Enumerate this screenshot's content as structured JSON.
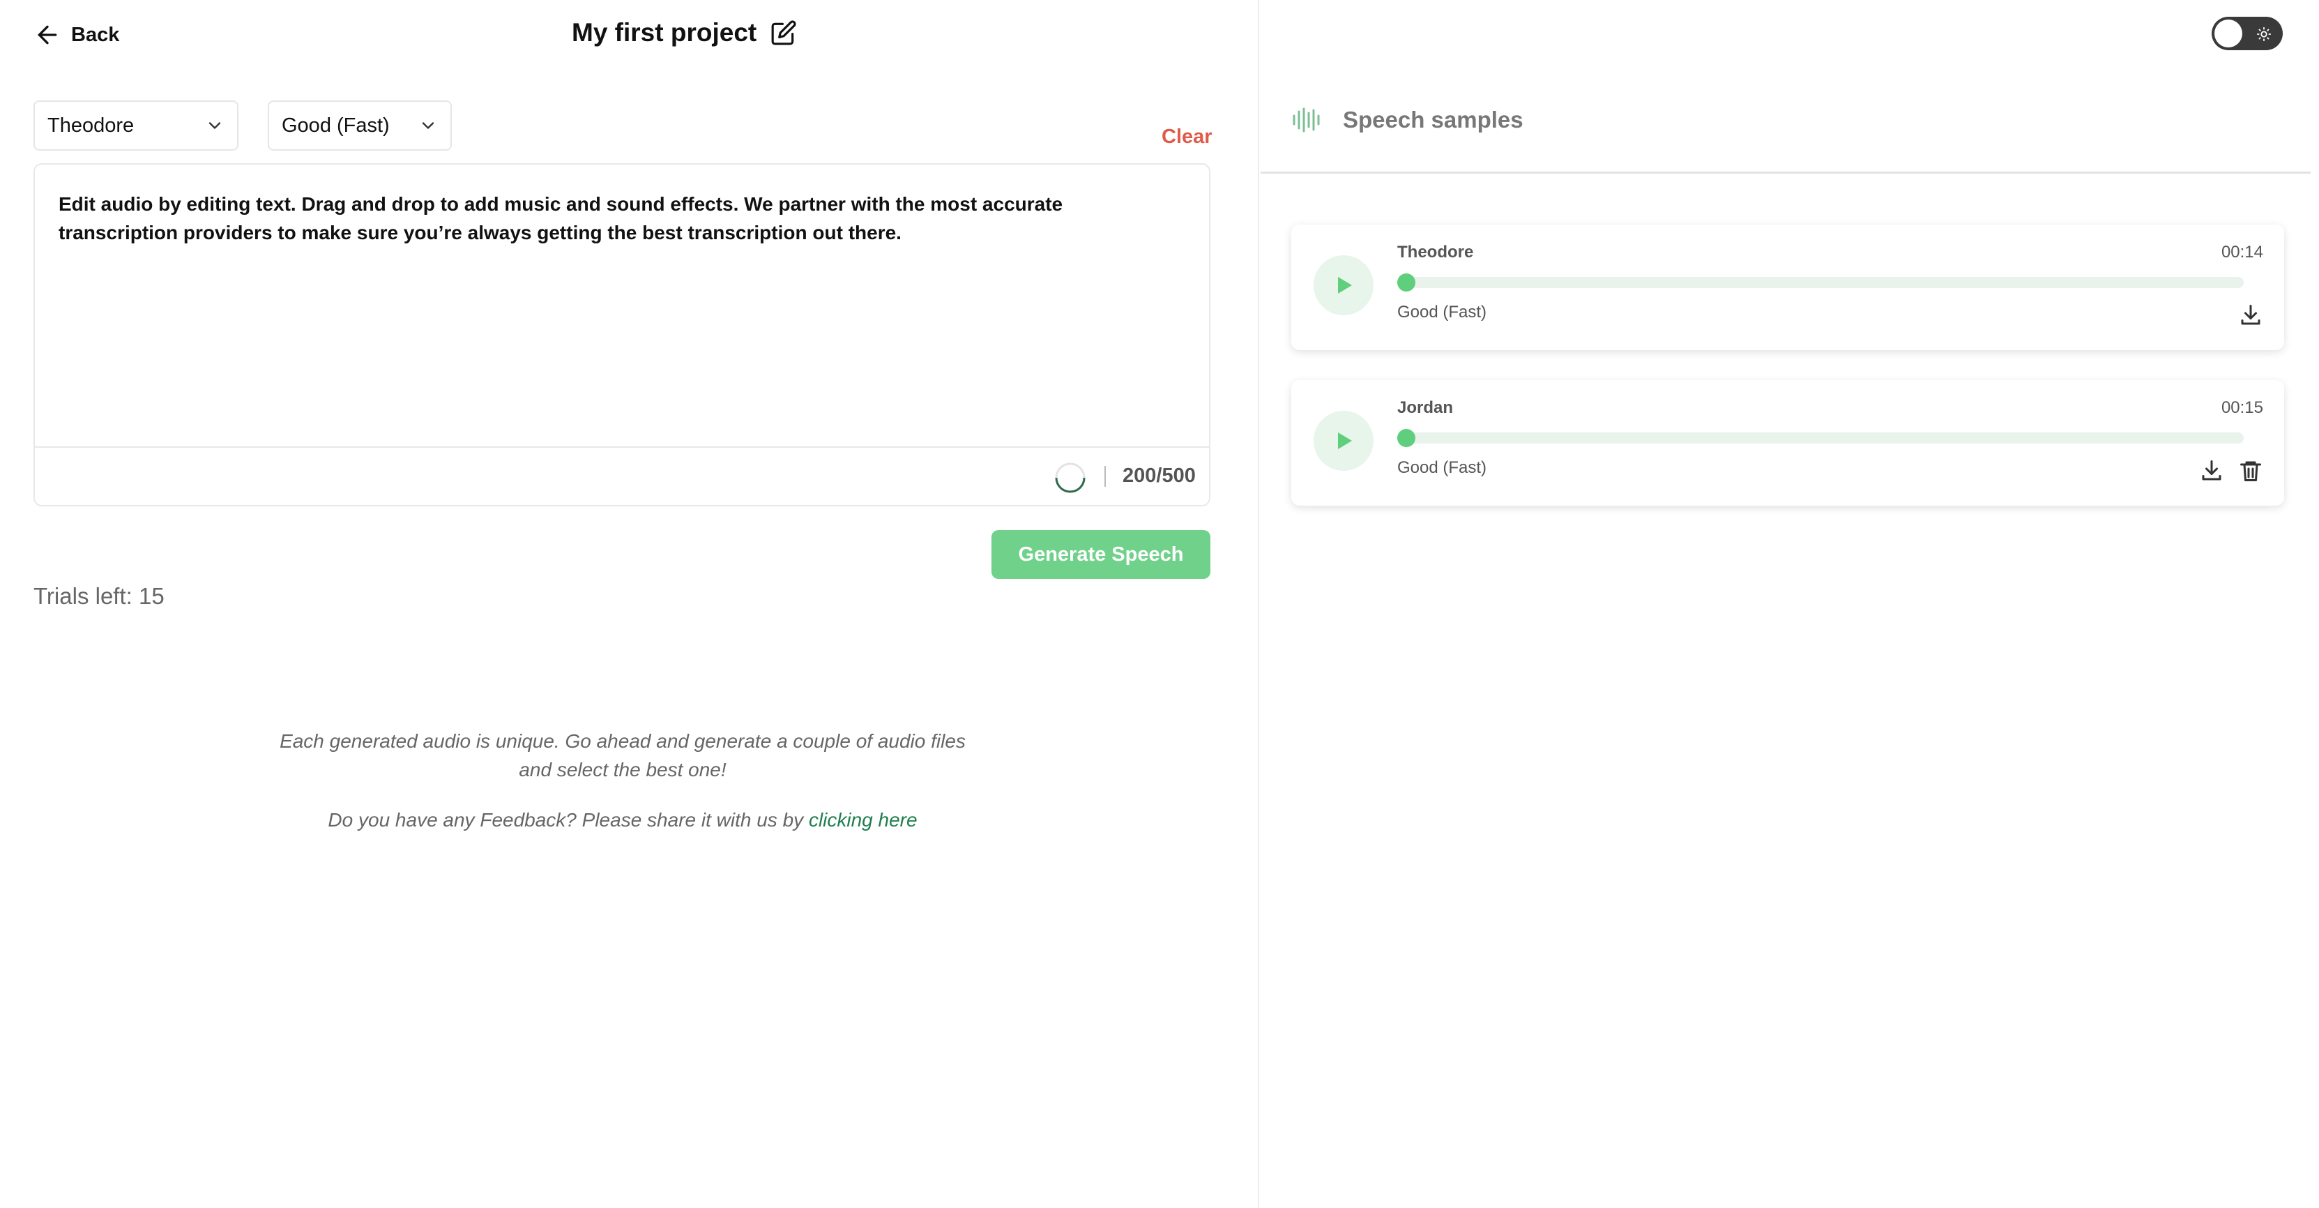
{
  "header": {
    "back_label": "Back",
    "project_title": "My first project"
  },
  "controls": {
    "voice_select": "Theodore",
    "quality_select": "Good (Fast)",
    "clear_label": "Clear"
  },
  "editor": {
    "text": "Edit audio by editing text. Drag and drop to add music and sound effects. We partner with the most accurate transcription providers to make sure you’re always getting the best transcription out there.",
    "char_count": "200/500"
  },
  "actions": {
    "generate_label": "Generate Speech",
    "trials_left": "Trials left: 15"
  },
  "notes": {
    "unique_line1": "Each generated audio is unique. Go ahead and generate a couple of audio files",
    "unique_line2": "and select the best one!",
    "feedback_prefix": "Do you have any Feedback? Please share it with us by",
    "feedback_link": "clicking here"
  },
  "right_panel": {
    "title": "Speech samples",
    "samples": [
      {
        "name": "Theodore",
        "duration": "00:14",
        "quality": "Good (Fast)",
        "progress": 0
      },
      {
        "name": "Jordan",
        "duration": "00:15",
        "quality": "Good (Fast)",
        "progress": 0
      }
    ]
  },
  "theme": {
    "accent": "#6fd18a",
    "clear_color": "#e05a4a",
    "link_color": "#1e7f4e",
    "toggle_state": "light"
  }
}
